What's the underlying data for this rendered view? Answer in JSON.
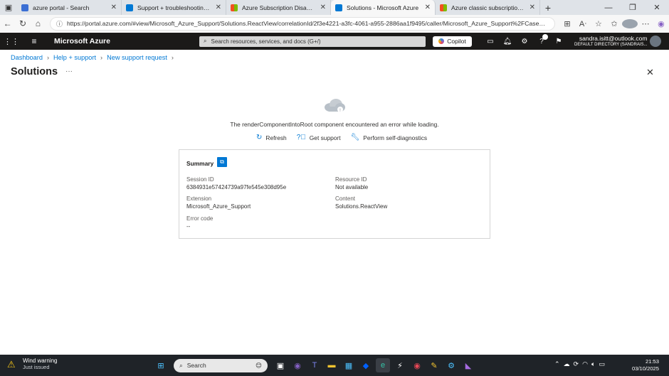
{
  "browser": {
    "tabs": [
      {
        "title": "azure portal - Search",
        "favicon_color": "#3b6fd4",
        "active": false
      },
      {
        "title": "Support + troubleshooting - Micr",
        "favicon_color": "#0078d4",
        "active": false
      },
      {
        "title": "Azure Subscription Disabled – Re",
        "favicon_color": "#f25022",
        "active": false
      },
      {
        "title": "Solutions - Microsoft Azure",
        "favicon_color": "#0078d4",
        "active": true
      },
      {
        "title": "Azure classic subscription admini",
        "favicon_color": "#f25022",
        "active": false
      }
    ],
    "url": "https://portal.azure.com/#view/Microsoft_Azure_Support/Solutions.ReactView/correlationId/2f3e4221-a3fc-4061-a955-2886aa1f9495/caller/Microsoft_Azure_Support%2FCaseSubmi..."
  },
  "azure_header": {
    "brand": "Microsoft Azure",
    "search_placeholder": "Search resources, services, and docs (G+/)",
    "copilot_label": "Copilot",
    "account_email": "sandra.isitt@outlook.com",
    "account_directory": "DEFAULT DIRECTORY (SANDRAIS..."
  },
  "breadcrumb": [
    "Dashboard",
    "Help + support",
    "New support request"
  ],
  "page": {
    "title": "Solutions",
    "error_message": "The renderComponentIntoRoot component encountered an error while loading.",
    "actions": {
      "refresh": "Refresh",
      "get_support": "Get support",
      "self_diagnostics": "Perform self-diagnostics"
    }
  },
  "summary": {
    "heading": "Summary",
    "session_id_label": "Session ID",
    "session_id": "6384931e57424739a97fe545e308d95e",
    "resource_id_label": "Resource ID",
    "resource_id": "Not available",
    "extension_label": "Extension",
    "extension": "Microsoft_Azure_Support",
    "content_label": "Content",
    "content": "Solutions.ReactView",
    "error_code_label": "Error code",
    "error_code": "--"
  },
  "taskbar": {
    "weather_title": "Wind warning",
    "weather_sub": "Just issued",
    "search_label": "Search",
    "time": "21:53",
    "date": "03/10/2025"
  },
  "colors": {
    "accent": "#0078d4",
    "azure_header": "#1b1a19",
    "taskbar": "#1f2328"
  }
}
